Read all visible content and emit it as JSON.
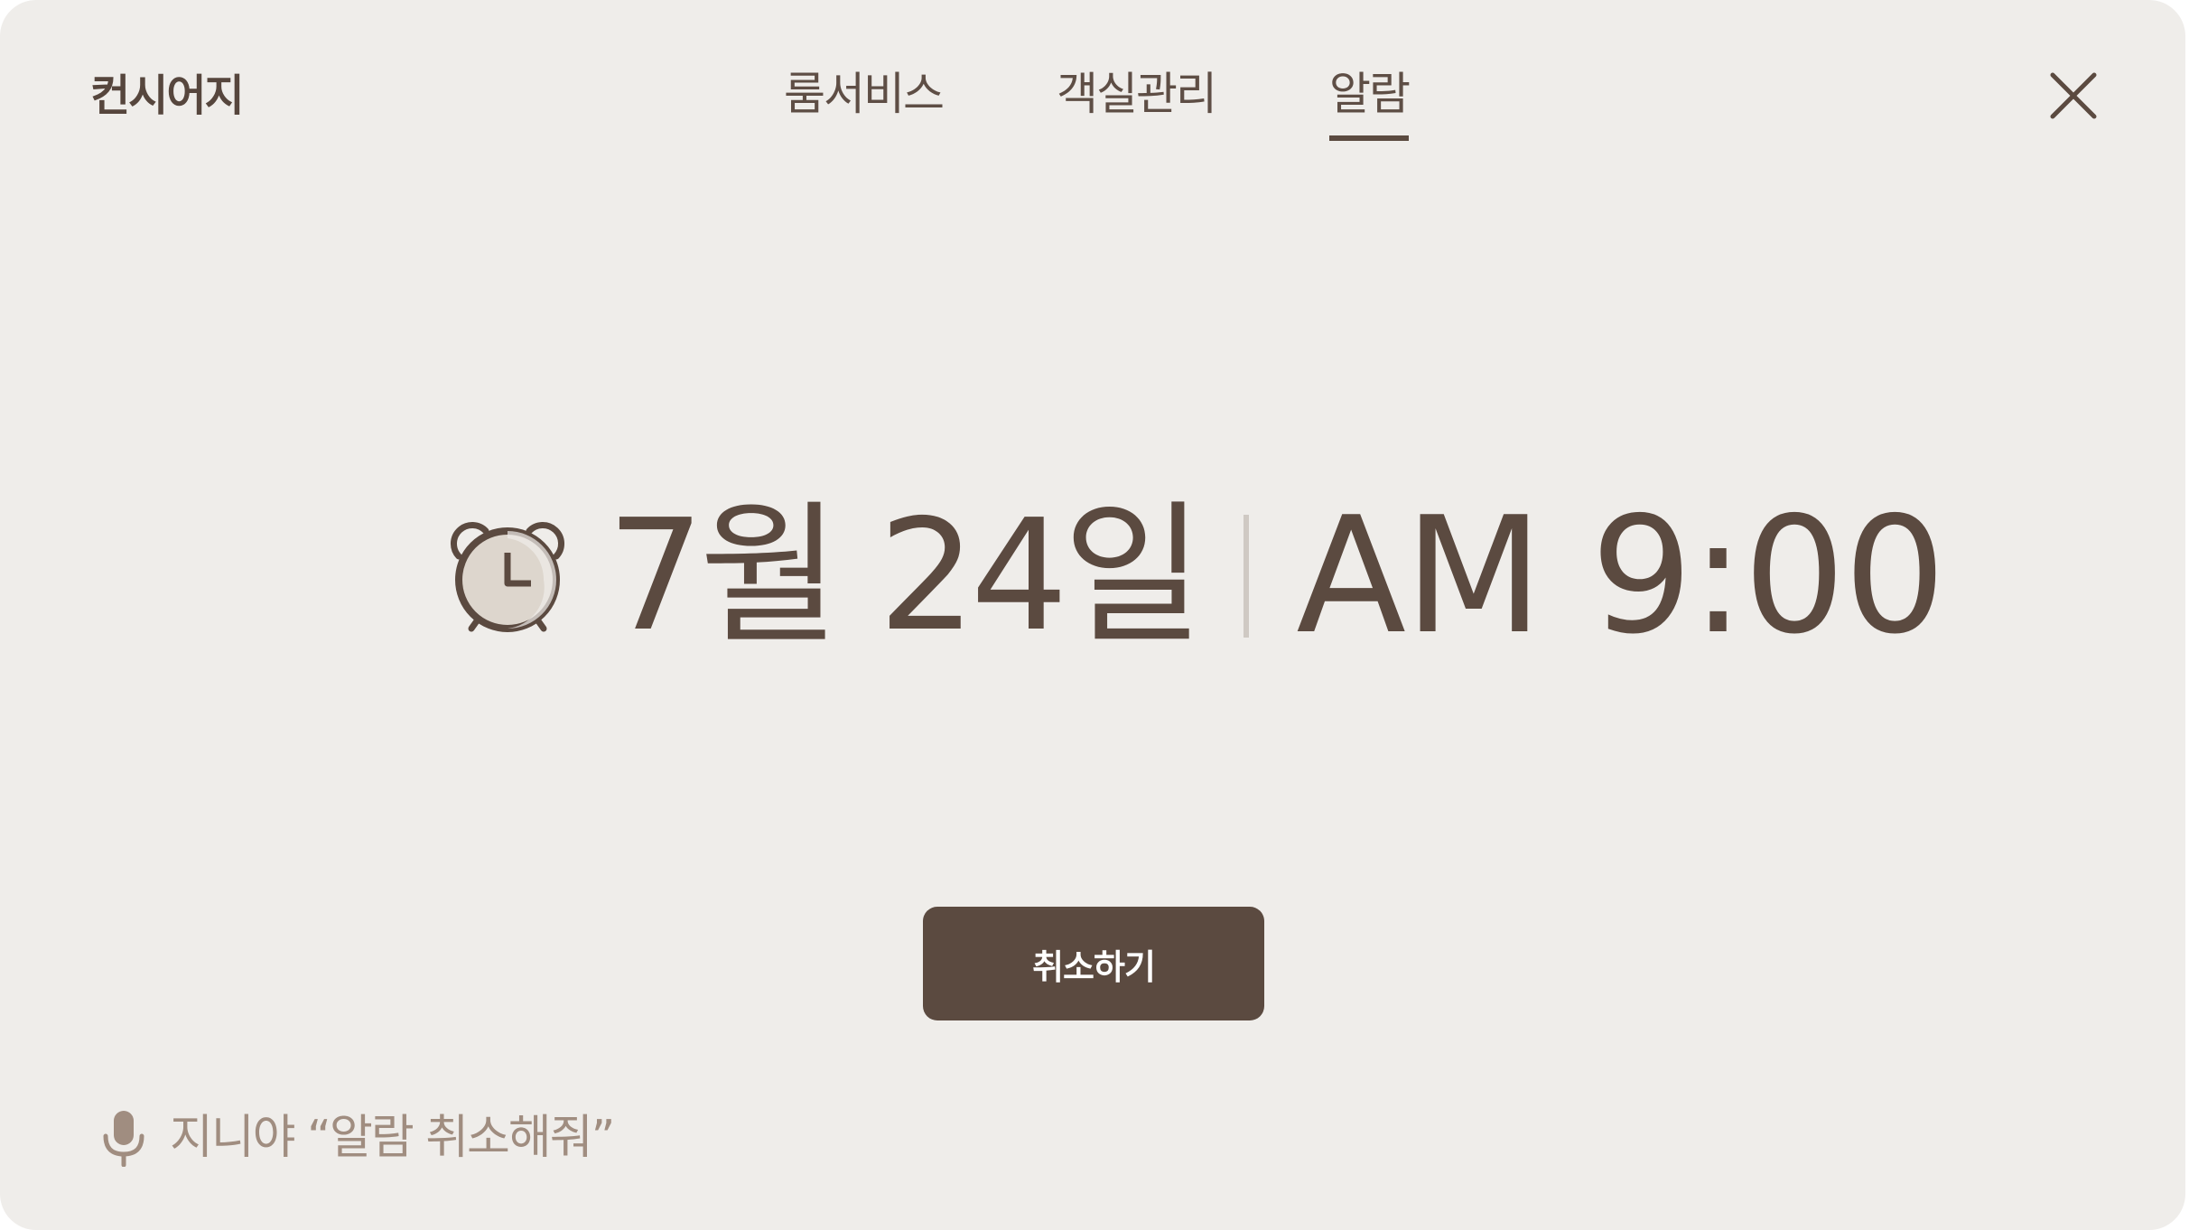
{
  "header": {
    "title": "컨시어지",
    "tabs": [
      {
        "label": "룸서비스",
        "active": false
      },
      {
        "label": "객실관리",
        "active": false
      },
      {
        "label": "알람",
        "active": true
      }
    ],
    "close_icon": "close-icon"
  },
  "alarm": {
    "icon": "alarm-clock-icon",
    "date": "7월 24일",
    "time": "AM 9:00"
  },
  "actions": {
    "cancel_label": "취소하기"
  },
  "voice_hint": {
    "icon": "microphone-icon",
    "text": "지니야 “알람 취소해줘”"
  },
  "colors": {
    "background": "#efedea",
    "primary": "#5b4a40",
    "hint": "#a08d80",
    "divider": "#cfc9c3"
  }
}
